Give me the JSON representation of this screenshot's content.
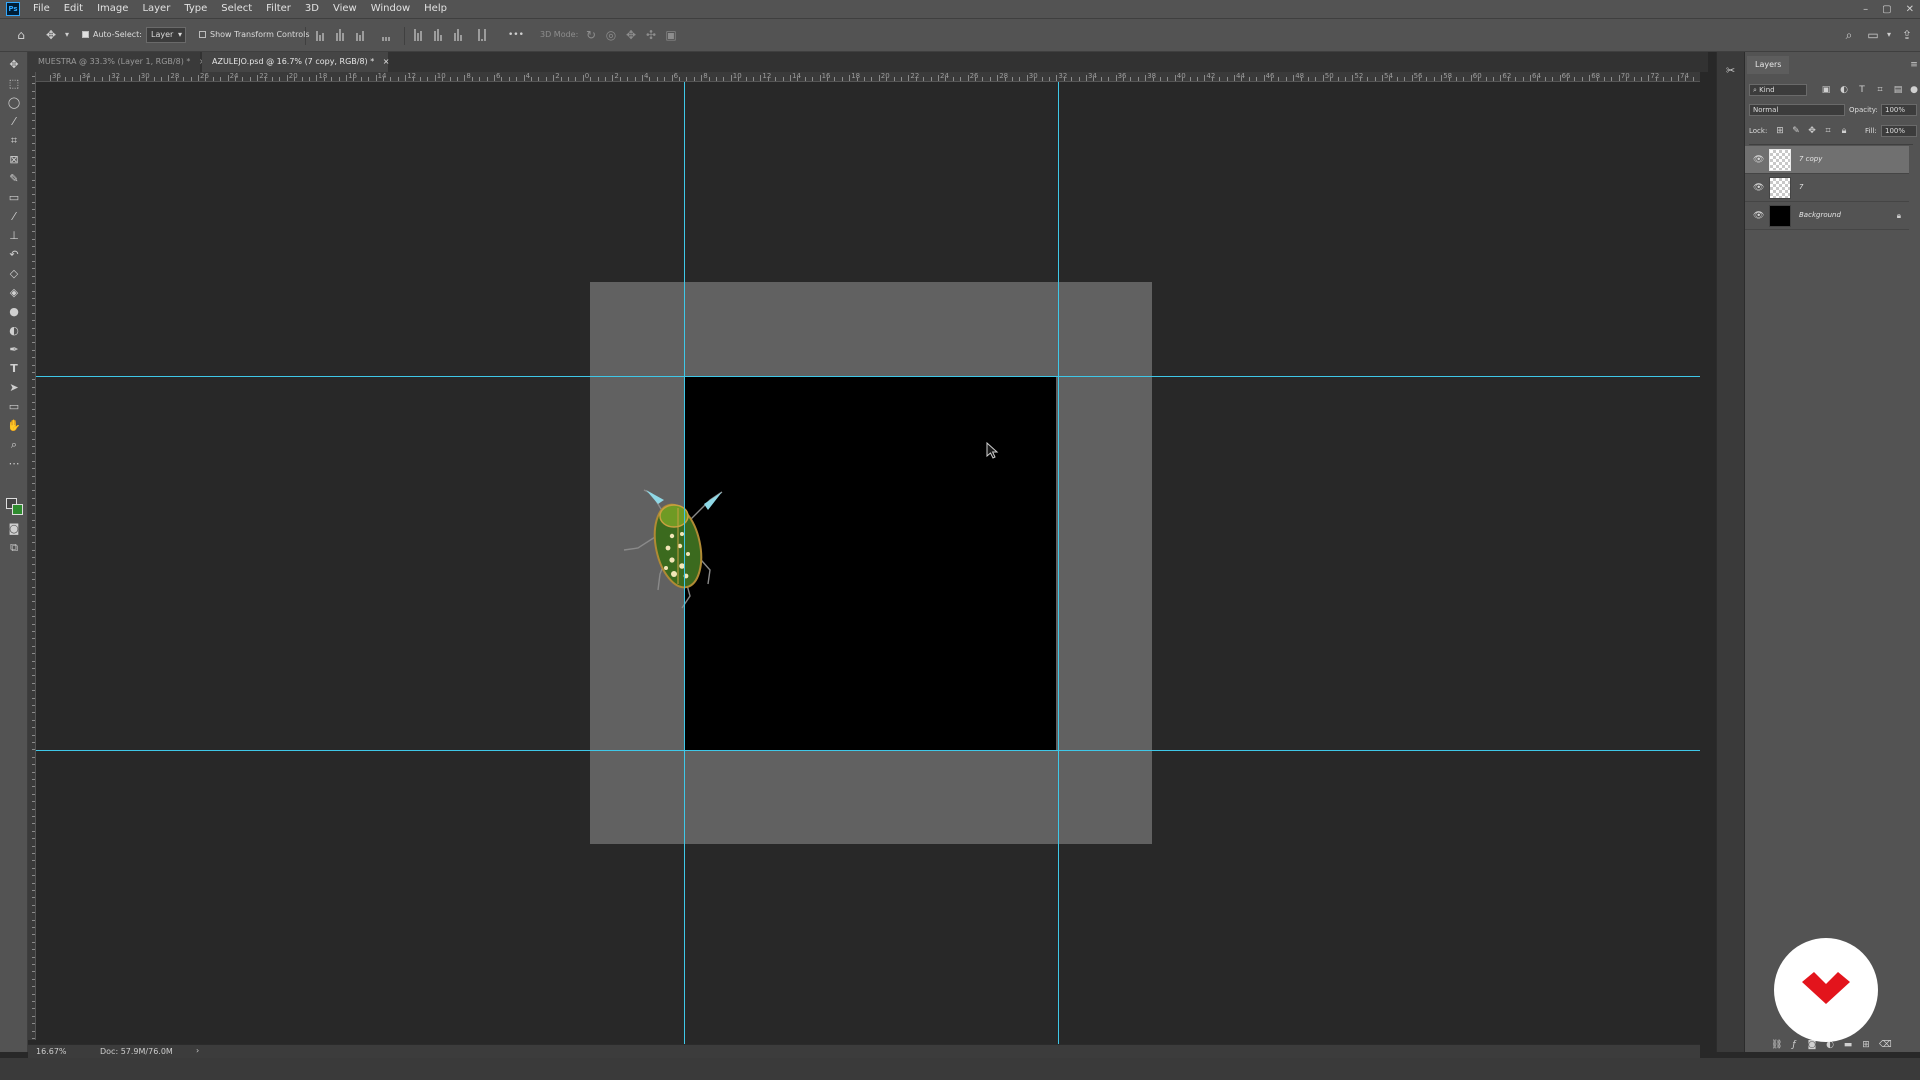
{
  "menubar": {
    "app_icon": "Ps",
    "items": [
      "File",
      "Edit",
      "Image",
      "Layer",
      "Type",
      "Select",
      "Filter",
      "3D",
      "View",
      "Window",
      "Help"
    ],
    "window_controls": [
      "–",
      "▢",
      "✕"
    ]
  },
  "options": {
    "auto_select_label": "Auto-Select:",
    "auto_select_value": "Layer",
    "show_transform_label": "Show Transform Controls",
    "mode_label": "3D Mode:",
    "more": "•••"
  },
  "tabs": [
    {
      "label": "MUESTRA @ 33.3% (Layer 1, RGB/8) *",
      "close": "×"
    },
    {
      "label": "AZULEJO.psd @ 16.7% (7 copy, RGB/8) *",
      "close": "×"
    }
  ],
  "ruler": {
    "labels": [
      "36",
      "34",
      "32",
      "30",
      "28",
      "26",
      "24",
      "22",
      "20",
      "18",
      "16",
      "14",
      "12",
      "10",
      "8",
      "6",
      "4",
      "2",
      "0",
      "2",
      "4",
      "6",
      "8",
      "10",
      "12",
      "14",
      "16",
      "18",
      "20",
      "22",
      "24",
      "26",
      "28",
      "30",
      "32",
      "34",
      "36",
      "38",
      "40",
      "42",
      "44",
      "46",
      "48",
      "50",
      "52",
      "54",
      "56",
      "58",
      "60",
      "62",
      "64",
      "66",
      "68",
      "70",
      "72",
      "74"
    ]
  },
  "status": {
    "zoom": "16.67%",
    "doc": "Doc: 57.9M/76.0M",
    "arrow": "›"
  },
  "layers": {
    "panel_title": "Layers",
    "filter_kind": "Kind",
    "blend_mode": "Normal",
    "opacity_label": "Opacity:",
    "opacity_value": "100%",
    "lock_label": "Lock:",
    "fill_label": "Fill:",
    "fill_value": "100%",
    "items": [
      {
        "name": "7 copy",
        "visible": true,
        "selected": true,
        "thumb": "transparent"
      },
      {
        "name": "7",
        "visible": true,
        "selected": false,
        "thumb": "transparent"
      },
      {
        "name": "Background",
        "visible": true,
        "selected": false,
        "thumb": "black",
        "locked": true
      }
    ],
    "footer_icons": [
      "link-icon",
      "fx-icon",
      "mask-icon",
      "adjustment-icon",
      "group-icon",
      "new-layer-icon",
      "trash-icon"
    ]
  },
  "colors": {
    "guide": "#3fc8e8",
    "brand_red": "#e3141c",
    "artboard": "#616161",
    "canvas": "#282828"
  }
}
